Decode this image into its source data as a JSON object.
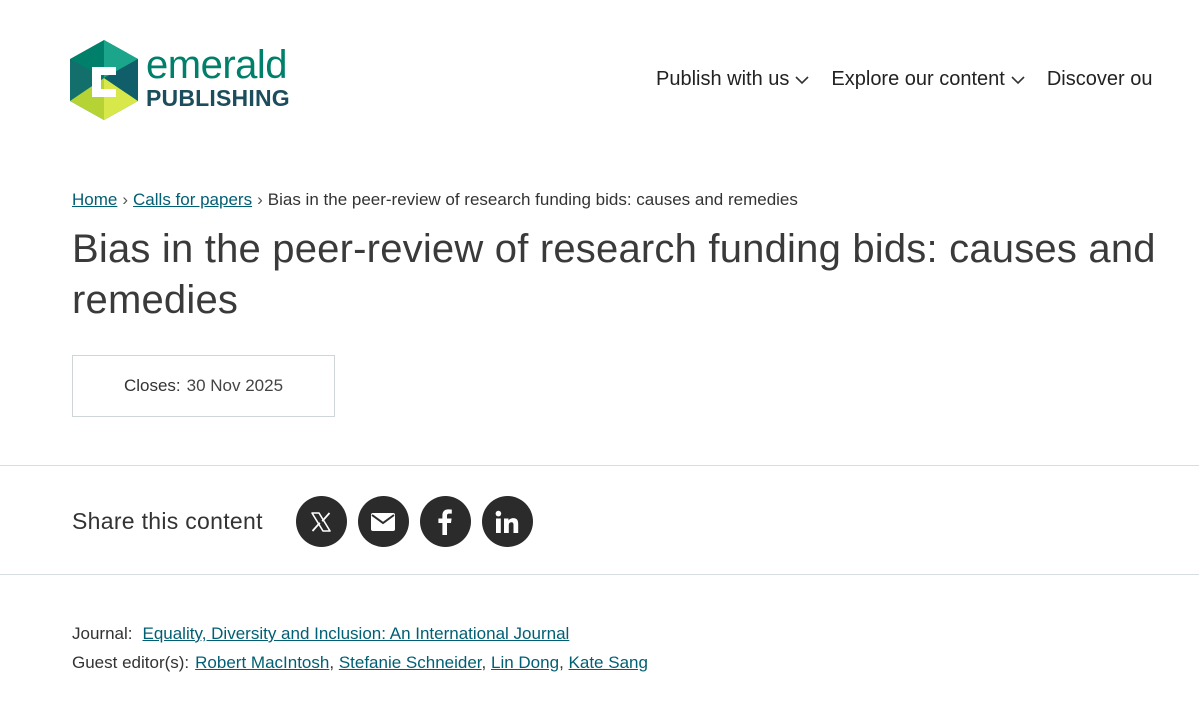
{
  "brand": {
    "name": "emerald",
    "subtitle": "PUBLISHING",
    "colors": {
      "teal": "#00806a",
      "navy": "#1b4d5c",
      "lime": "#b5d334"
    }
  },
  "nav": {
    "items": [
      {
        "label": "Publish with us",
        "icon": "chevron-down-icon"
      },
      {
        "label": "Explore our content",
        "icon": "chevron-down-icon"
      },
      {
        "label": "Discover ou"
      }
    ]
  },
  "breadcrumb": {
    "home": "Home",
    "calls": "Calls for papers",
    "current": "Bias in the peer-review of research funding bids: causes and remedies",
    "separator": "›"
  },
  "page": {
    "title": "Bias in the peer-review of research funding bids: causes and remedies"
  },
  "closes": {
    "label": "Closes:",
    "date": "30 Nov 2025"
  },
  "share": {
    "label": "Share this content",
    "icons": [
      "x-icon",
      "email-icon",
      "facebook-icon",
      "linkedin-icon"
    ]
  },
  "meta": {
    "journal_label": "Journal:",
    "journal": "Equality, Diversity and Inclusion: An International Journal",
    "editors_label": "Guest editor(s):",
    "editors": [
      "Robert MacIntosh",
      "Stefanie Schneider",
      "Lin Dong",
      "Kate Sang"
    ],
    "editor_separator": ","
  },
  "colors": {
    "link": "#005f73",
    "text": "#333333",
    "share_button": "#2b2b2b",
    "divider": "#d7dedf"
  }
}
